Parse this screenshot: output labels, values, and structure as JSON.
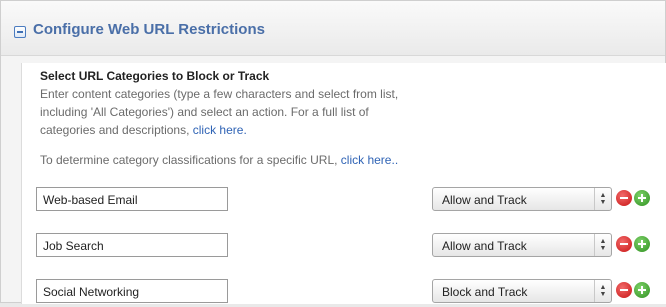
{
  "panel": {
    "title": "Configure Web URL Restrictions"
  },
  "section": {
    "heading": "Select URL Categories to Block or Track",
    "description_lines": [
      "Enter content categories (type a few characters and select from list,",
      "including 'All Categories') and select an action. For a full list of",
      "categories and descriptions, "
    ],
    "categories_link": "click here.",
    "determine_text": "To determine category classifications for a specific URL, ",
    "determine_link": "click here.."
  },
  "rows": [
    {
      "category": "Web-based Email",
      "action": "Allow and Track"
    },
    {
      "category": "Job Search",
      "action": "Allow and Track"
    },
    {
      "category": "Social Networking",
      "action": "Block and Track"
    }
  ],
  "colors": {
    "title": "#4a6fa8",
    "link": "#2f63b5",
    "remove": "#c81414",
    "add": "#2e8f1f"
  },
  "icons": {
    "collapse": "minus-square-icon",
    "remove": "remove-circle-icon",
    "add": "add-circle-icon",
    "select_arrows": "up-down-arrows-icon"
  }
}
